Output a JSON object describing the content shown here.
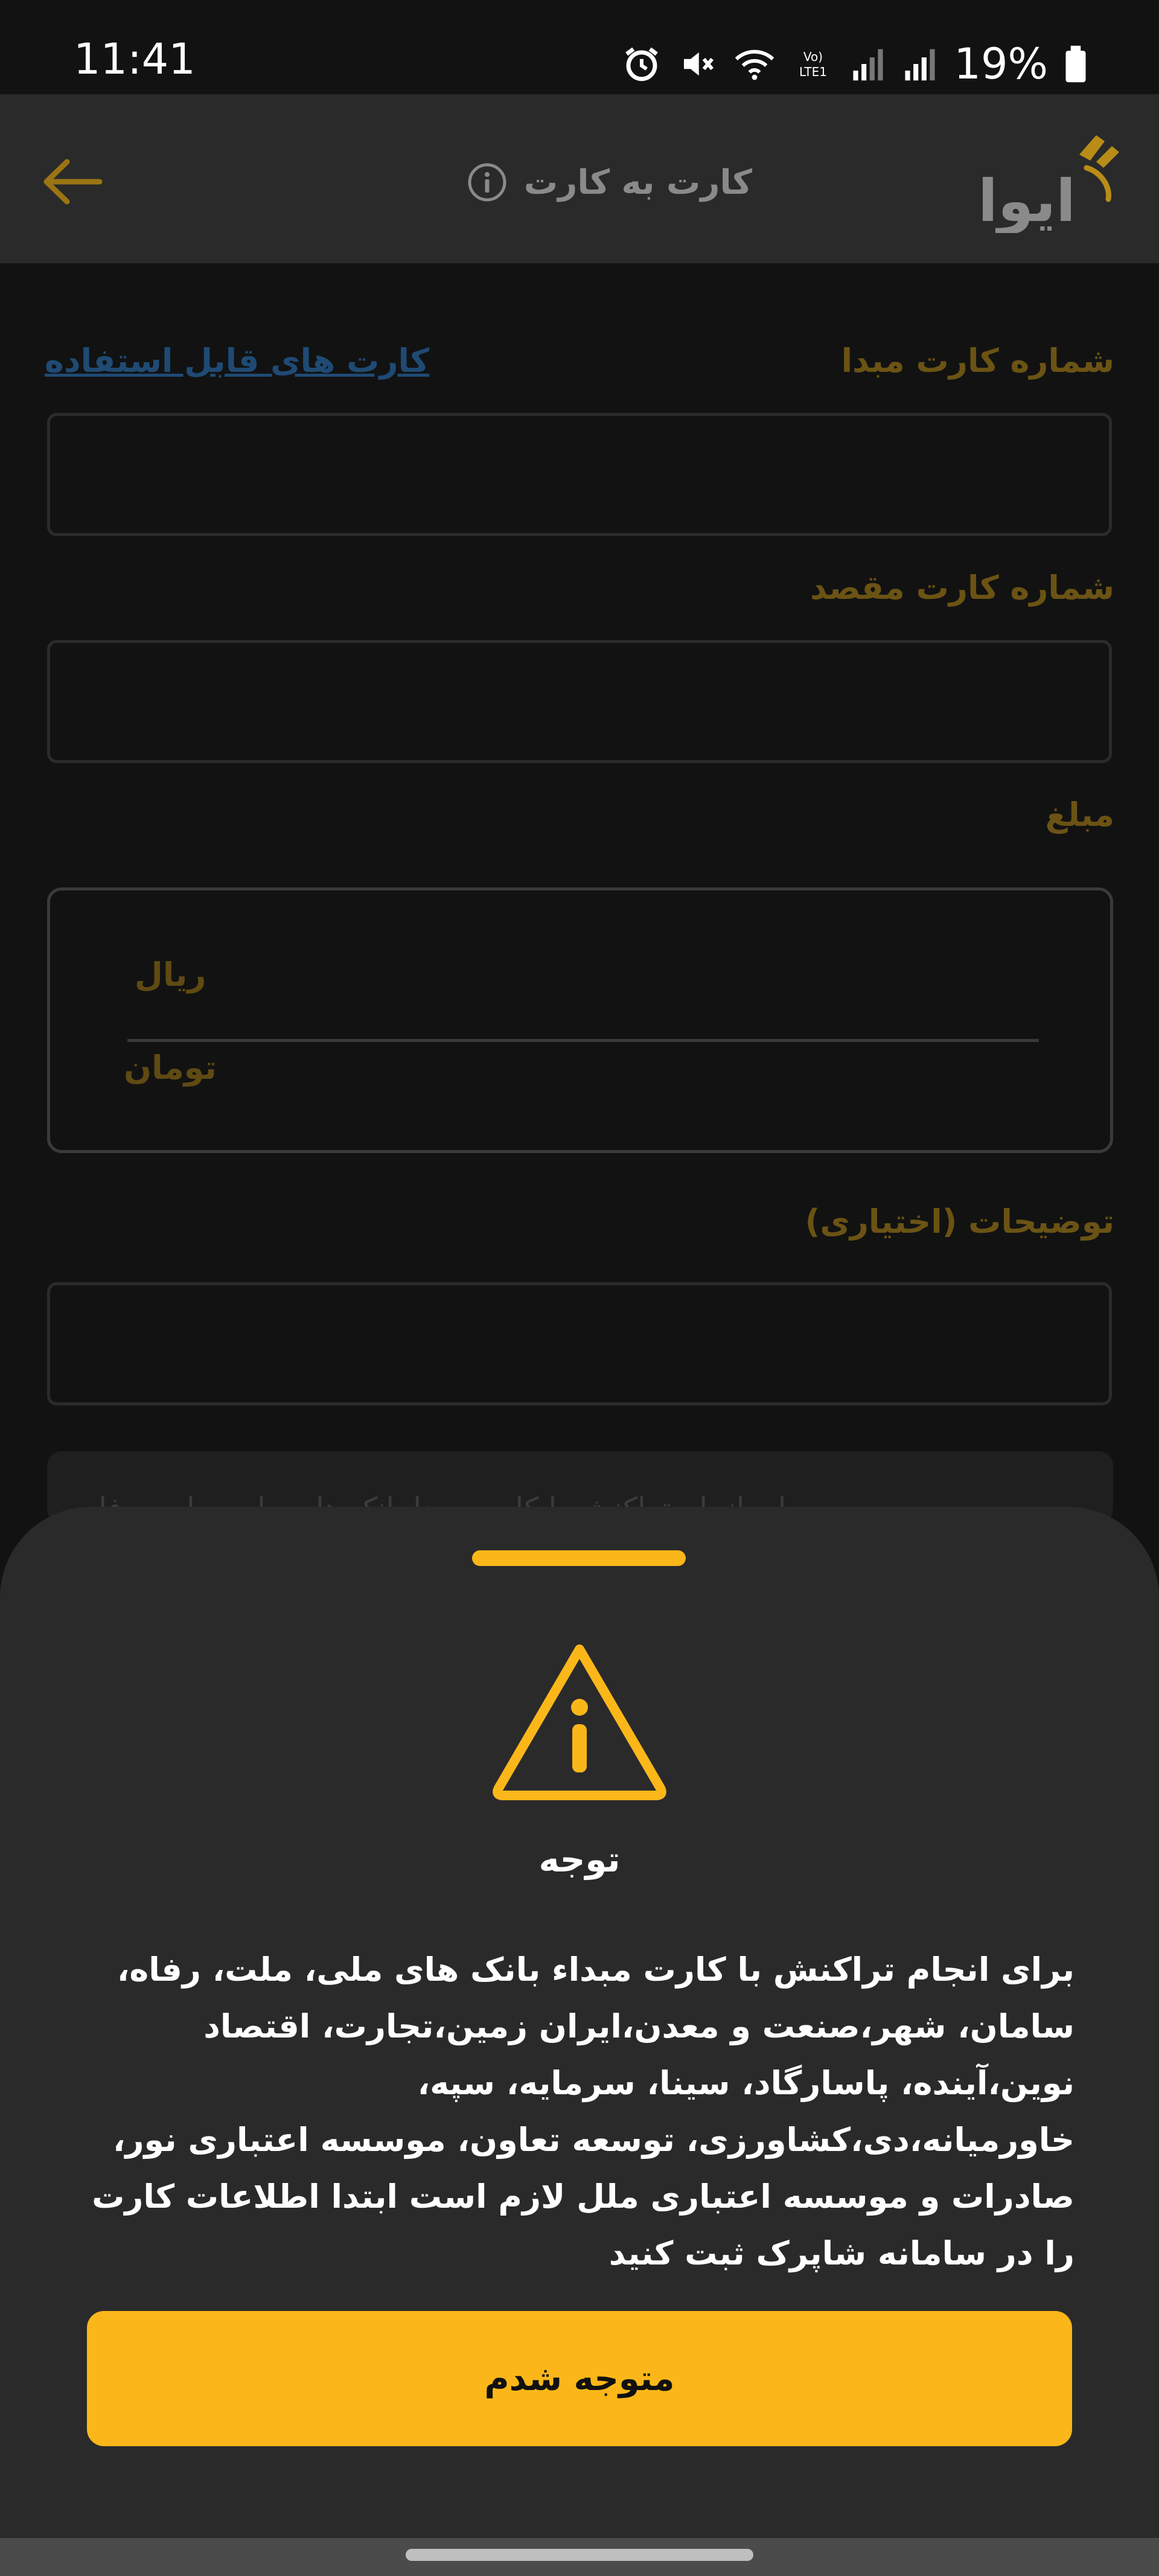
{
  "status_bar": {
    "time": "11:41",
    "battery": "19%",
    "network_label": "Vo) LTE1",
    "icons": [
      "alarm-icon",
      "mute-icon",
      "wifi-icon",
      "signal-icon",
      "signal-icon",
      "battery-icon"
    ]
  },
  "app_bar": {
    "title": "کارت به کارت",
    "brand_name": "ایوا",
    "back_icon": "arrow-left-icon",
    "info_icon": "info-icon"
  },
  "form": {
    "source_card_label": "شماره کارت مبدا",
    "usable_cards_link": "کارت های قابل استفاده",
    "destination_card_label": "شماره کارت مقصد",
    "amount_label": "مبلغ",
    "currency_options": [
      "ریال",
      "تومان"
    ],
    "description_label": "توضیحات (اختیاری)",
    "notice_preview": "برای انجام تراکنش با کارت مبدا بانک های ملی، ملت، رفاه"
  },
  "bottom_sheet": {
    "title": "توجه",
    "message": "برای انجام تراکنش با کارت مبداء بانک های ملی، ملت، رفاه، سامان، شهر،صنعت و معدن،ایران زمین،تجارت، اقتصاد نوین،آینده، پاسارگاد، سینا، سرمایه، سپه، خاورمیانه،دی،کشاورزی، توسعه تعاون، موسسه اعتباری نور، صادرات و موسسه اعتباری ملل لازم است ابتدا اطلاعات کارت را در سامانه شاپرک ثبت کنید",
    "confirm_button": "متوجه شدم",
    "icon": "warning-icon"
  },
  "colors": {
    "accent": "#fbb719",
    "background": "#121212",
    "surface": "#2a2a2b"
  }
}
